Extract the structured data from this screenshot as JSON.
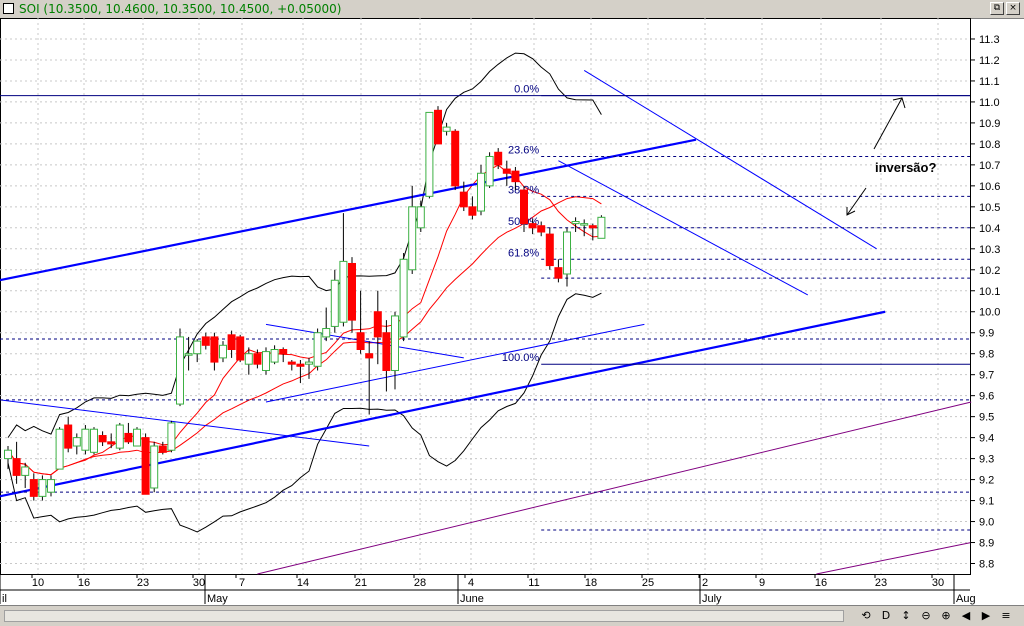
{
  "window": {
    "title": "SOI (10.3500, 10.4600, 10.3500, 10.4500, +0.05000)",
    "restore_label": "⧉",
    "close_label": "×"
  },
  "statusbar": {
    "buttons": [
      {
        "name": "scroll-lock-icon",
        "label": "⟲"
      },
      {
        "name": "period-day-button",
        "label": "D"
      },
      {
        "name": "zoom-vertical-icon",
        "label": "↕"
      },
      {
        "name": "zoom-out-icon",
        "label": "⊖"
      },
      {
        "name": "zoom-in-icon",
        "label": "⊕"
      },
      {
        "name": "scroll-left-icon",
        "label": "◀"
      },
      {
        "name": "scroll-right-icon",
        "label": "▶"
      },
      {
        "name": "menu-icon",
        "label": "≡"
      }
    ]
  },
  "chart_data": {
    "type": "candlestick",
    "colors": {
      "up": "#3cb043",
      "down": "#ff0000",
      "wick": "#000000",
      "bollinger": "#000000",
      "ma": "#ff0000",
      "trend_blue": "#0000ff",
      "channel_purple": "#800080",
      "fib": "#000080"
    },
    "ylim": [
      8.75,
      11.4
    ],
    "y_ticks": [
      "8.8",
      "8.9",
      "9.0",
      "9.1",
      "9.2",
      "9.3",
      "9.4",
      "9.5",
      "9.6",
      "9.7",
      "9.8",
      "9.9",
      "10.0",
      "10.1",
      "10.2",
      "10.3",
      "10.4",
      "10.5",
      "10.6",
      "10.7",
      "10.8",
      "10.9",
      "11.0",
      "11.1",
      "11.2",
      "11.3"
    ],
    "x_ticks": [
      "10",
      "16",
      "23",
      "30",
      "7",
      "14",
      "21",
      "28",
      "4",
      "11",
      "18",
      "25",
      "2",
      "9",
      "16",
      "23",
      "30"
    ],
    "months": [
      "il",
      "May",
      "June",
      "July",
      "Aug"
    ],
    "grid": true,
    "fibonacci": [
      {
        "label": "0.0%",
        "value": 11.03
      },
      {
        "label": "23.6%",
        "value": 10.74
      },
      {
        "label": "38.2%",
        "value": 10.55
      },
      {
        "label": "50.0%",
        "value": 10.4
      },
      {
        "label": "61.8%",
        "value": 10.25
      },
      {
        "label": "100.0%",
        "value": 9.75
      }
    ],
    "annotation": "inversão?",
    "candles": [
      {
        "o": 9.3,
        "h": 9.36,
        "l": 9.25,
        "c": 9.34
      },
      {
        "o": 9.3,
        "h": 9.38,
        "l": 9.18,
        "c": 9.22
      },
      {
        "o": 9.22,
        "h": 9.28,
        "l": 9.16,
        "c": 9.26
      },
      {
        "o": 9.2,
        "h": 9.23,
        "l": 9.1,
        "c": 9.12
      },
      {
        "o": 9.12,
        "h": 9.22,
        "l": 9.1,
        "c": 9.2
      },
      {
        "o": 9.14,
        "h": 9.22,
        "l": 9.12,
        "c": 9.2
      },
      {
        "o": 9.25,
        "h": 9.45,
        "l": 9.25,
        "c": 9.44
      },
      {
        "o": 9.46,
        "h": 9.5,
        "l": 9.33,
        "c": 9.35
      },
      {
        "o": 9.36,
        "h": 9.42,
        "l": 9.32,
        "c": 9.4
      },
      {
        "o": 9.34,
        "h": 9.46,
        "l": 9.32,
        "c": 9.44
      },
      {
        "o": 9.33,
        "h": 9.45,
        "l": 9.32,
        "c": 9.44
      },
      {
        "o": 9.41,
        "h": 9.43,
        "l": 9.36,
        "c": 9.38
      },
      {
        "o": 9.38,
        "h": 9.42,
        "l": 9.35,
        "c": 9.37
      },
      {
        "o": 9.35,
        "h": 9.47,
        "l": 9.34,
        "c": 9.46
      },
      {
        "o": 9.42,
        "h": 9.47,
        "l": 9.37,
        "c": 9.38
      },
      {
        "o": 9.36,
        "h": 9.45,
        "l": 9.36,
        "c": 9.44
      },
      {
        "o": 9.4,
        "h": 9.42,
        "l": 9.13,
        "c": 9.13
      },
      {
        "o": 9.16,
        "h": 9.38,
        "l": 9.14,
        "c": 9.36
      },
      {
        "o": 9.36,
        "h": 9.38,
        "l": 9.32,
        "c": 9.33
      },
      {
        "o": 9.34,
        "h": 9.48,
        "l": 9.33,
        "c": 9.47
      },
      {
        "o": 9.56,
        "h": 9.92,
        "l": 9.55,
        "c": 9.88
      },
      {
        "o": 9.8,
        "h": 9.88,
        "l": 9.72,
        "c": 9.8
      },
      {
        "o": 9.8,
        "h": 9.87,
        "l": 9.76,
        "c": 9.86
      },
      {
        "o": 9.88,
        "h": 9.9,
        "l": 9.82,
        "c": 9.84
      },
      {
        "o": 9.88,
        "h": 9.9,
        "l": 9.72,
        "c": 9.76
      },
      {
        "o": 9.78,
        "h": 9.86,
        "l": 9.76,
        "c": 9.84
      },
      {
        "o": 9.89,
        "h": 9.91,
        "l": 9.78,
        "c": 9.82
      },
      {
        "o": 9.88,
        "h": 9.89,
        "l": 9.76,
        "c": 9.77
      },
      {
        "o": 9.75,
        "h": 9.83,
        "l": 9.7,
        "c": 9.8
      },
      {
        "o": 9.8,
        "h": 9.82,
        "l": 9.73,
        "c": 9.75
      },
      {
        "o": 9.72,
        "h": 9.83,
        "l": 9.7,
        "c": 9.81
      },
      {
        "o": 9.76,
        "h": 9.84,
        "l": 9.75,
        "c": 9.82
      },
      {
        "o": 9.82,
        "h": 9.83,
        "l": 9.76,
        "c": 9.8
      },
      {
        "o": 9.76,
        "h": 9.77,
        "l": 9.72,
        "c": 9.75
      },
      {
        "o": 9.75,
        "h": 9.77,
        "l": 9.66,
        "c": 9.74
      },
      {
        "o": 9.75,
        "h": 9.78,
        "l": 9.68,
        "c": 9.76
      },
      {
        "o": 9.74,
        "h": 9.92,
        "l": 9.72,
        "c": 9.9
      },
      {
        "o": 9.88,
        "h": 10.02,
        "l": 9.86,
        "c": 9.92
      },
      {
        "o": 9.93,
        "h": 10.2,
        "l": 9.9,
        "c": 10.15
      },
      {
        "o": 9.95,
        "h": 10.47,
        "l": 9.93,
        "c": 10.24
      },
      {
        "o": 10.23,
        "h": 10.26,
        "l": 9.9,
        "c": 9.96
      },
      {
        "o": 9.9,
        "h": 10.1,
        "l": 9.8,
        "c": 9.82
      },
      {
        "o": 9.8,
        "h": 9.86,
        "l": 9.51,
        "c": 9.78
      },
      {
        "o": 10.0,
        "h": 10.1,
        "l": 9.75,
        "c": 9.88
      },
      {
        "o": 9.9,
        "h": 9.96,
        "l": 9.62,
        "c": 9.72
      },
      {
        "o": 9.72,
        "h": 10.0,
        "l": 9.63,
        "c": 9.98
      },
      {
        "o": 9.88,
        "h": 10.28,
        "l": 9.86,
        "c": 10.25
      },
      {
        "o": 10.2,
        "h": 10.6,
        "l": 10.18,
        "c": 10.5
      },
      {
        "o": 10.4,
        "h": 10.53,
        "l": 10.38,
        "c": 10.5
      },
      {
        "o": 10.55,
        "h": 10.85,
        "l": 10.54,
        "c": 10.95
      },
      {
        "o": 10.96,
        "h": 10.98,
        "l": 10.8,
        "c": 10.8
      },
      {
        "o": 10.86,
        "h": 10.9,
        "l": 10.84,
        "c": 10.88
      },
      {
        "o": 10.86,
        "h": 10.87,
        "l": 10.58,
        "c": 10.6
      },
      {
        "o": 10.57,
        "h": 10.62,
        "l": 10.48,
        "c": 10.5
      },
      {
        "o": 10.5,
        "h": 10.55,
        "l": 10.44,
        "c": 10.46
      },
      {
        "o": 10.48,
        "h": 10.7,
        "l": 10.46,
        "c": 10.66
      },
      {
        "o": 10.6,
        "h": 10.76,
        "l": 10.59,
        "c": 10.74
      },
      {
        "o": 10.76,
        "h": 10.78,
        "l": 10.68,
        "c": 10.7
      },
      {
        "o": 10.68,
        "h": 10.72,
        "l": 10.6,
        "c": 10.66
      },
      {
        "o": 10.67,
        "h": 10.69,
        "l": 10.58,
        "c": 10.62
      },
      {
        "o": 10.58,
        "h": 10.6,
        "l": 10.38,
        "c": 10.42
      },
      {
        "o": 10.42,
        "h": 10.44,
        "l": 10.37,
        "c": 10.4
      },
      {
        "o": 10.41,
        "h": 10.43,
        "l": 10.36,
        "c": 10.38
      },
      {
        "o": 10.37,
        "h": 10.4,
        "l": 10.2,
        "c": 10.22
      },
      {
        "o": 10.21,
        "h": 10.25,
        "l": 10.14,
        "c": 10.16
      },
      {
        "o": 10.18,
        "h": 10.4,
        "l": 10.12,
        "c": 10.38
      },
      {
        "o": 10.42,
        "h": 10.45,
        "l": 10.38,
        "c": 10.43
      },
      {
        "o": 10.42,
        "h": 10.44,
        "l": 10.36,
        "c": 10.42
      },
      {
        "o": 10.41,
        "h": 10.42,
        "l": 10.34,
        "c": 10.4
      },
      {
        "o": 10.35,
        "h": 10.46,
        "l": 10.35,
        "c": 10.45
      }
    ]
  }
}
